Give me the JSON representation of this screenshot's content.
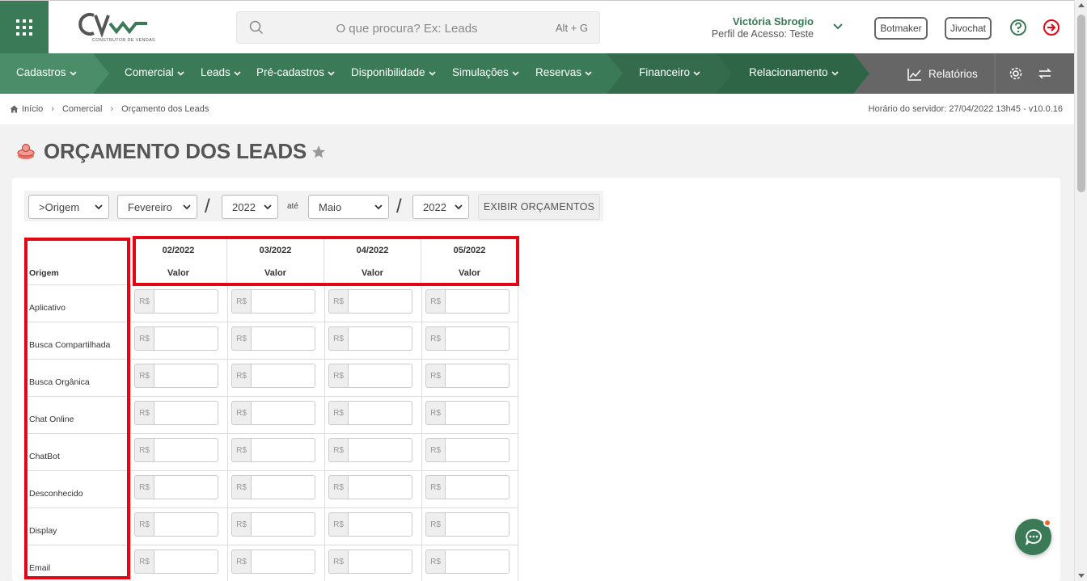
{
  "header": {
    "logo_text": "CV",
    "logo_subtitle": "CONSTRUTOR DE VENDAS",
    "search_placeholder": "O que procura? Ex: Leads",
    "search_shortcut": "Alt + G",
    "user_name": "Victória Sbrogio",
    "user_profile": "Perfil de Acesso: Teste",
    "botmaker_label": "Botmaker",
    "jivochat_label": "Jivochat"
  },
  "nav": {
    "items": [
      "Cadastros",
      "Comercial",
      "Leads",
      "Pré-cadastros",
      "Disponibilidade",
      "Simulações",
      "Reservas",
      "Financeiro",
      "Relacionamento"
    ],
    "reports_label": "Relatórios"
  },
  "breadcrumb": {
    "items": [
      "Início",
      "Comercial",
      "Orçamento dos Leads"
    ],
    "server_time": "Horário do servidor: 27/04/2022 13h45 - v10.0.16"
  },
  "page": {
    "title": "ORÇAMENTO DOS LEADS"
  },
  "filters": {
    "origin": ">Origem",
    "month_from": "Fevereiro",
    "year_from": "2022",
    "separator": "/",
    "until": "até",
    "month_to": "Maio",
    "year_to": "2022",
    "button": "EXIBIR ORÇAMENTOS"
  },
  "table": {
    "origin_header": "Origem",
    "value_header": "Valor",
    "currency": "R$",
    "months": [
      "02/2022",
      "03/2022",
      "04/2022",
      "05/2022"
    ],
    "rows": [
      "Aplicativo",
      "Busca Compartilhada",
      "Busca Orgânica",
      "Chat Online",
      "ChatBot",
      "Desconhecido",
      "Display",
      "Email"
    ]
  },
  "colors": {
    "brand_green": "#3b7a57",
    "nav_dark": "#666666",
    "highlight_red": "#e30613",
    "notification_orange": "#f26522"
  }
}
